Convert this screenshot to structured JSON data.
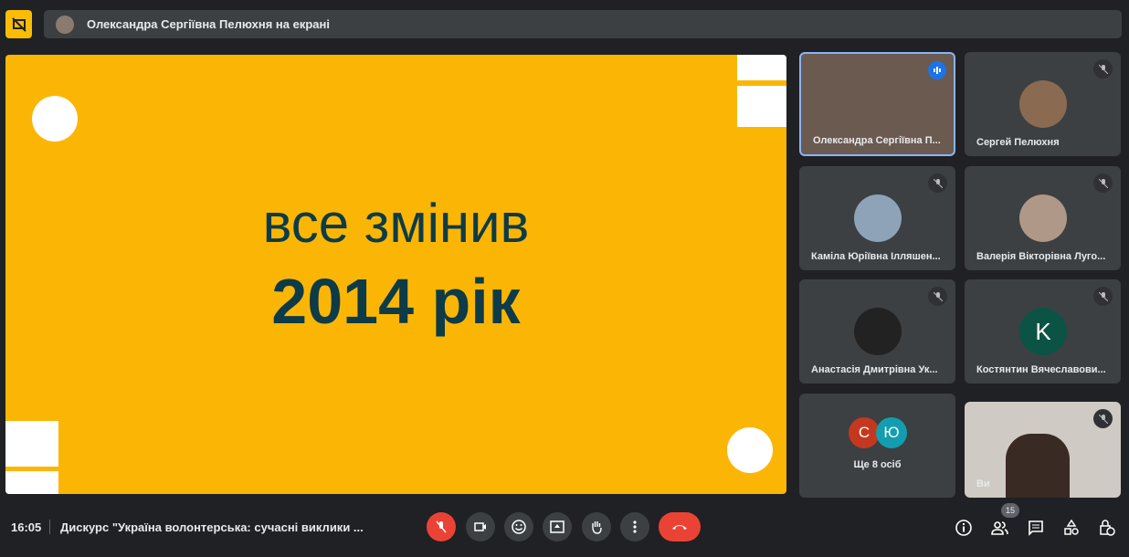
{
  "banner": {
    "text": "Олександра Сергіївна Пелюхня на екрані"
  },
  "slide": {
    "line1": "все змінив",
    "line2": "2014 рік"
  },
  "participants": [
    {
      "name": "Олександра Сергіївна П...",
      "speaking": true
    },
    {
      "name": "Сергей Пелюхня"
    },
    {
      "name": "Каміла Юріївна Ілляшен..."
    },
    {
      "name": "Валерія Вікторівна Луго..."
    },
    {
      "name": "Анастасія Дмитрівна Ук..."
    },
    {
      "name": "Костянтин Вячеславови...",
      "initial": "K"
    },
    {
      "name": "Ще 8 осіб",
      "initials": [
        "С",
        "Ю"
      ]
    },
    {
      "name": "Ви"
    }
  ],
  "footer": {
    "time": "16:05",
    "title": "Дискурс \"Україна волонтерська: сучасні виклики ...",
    "people_count": "15"
  },
  "colors": {
    "accent": "#fbb605",
    "end": "#ea4335",
    "text": "#0d3b47"
  }
}
